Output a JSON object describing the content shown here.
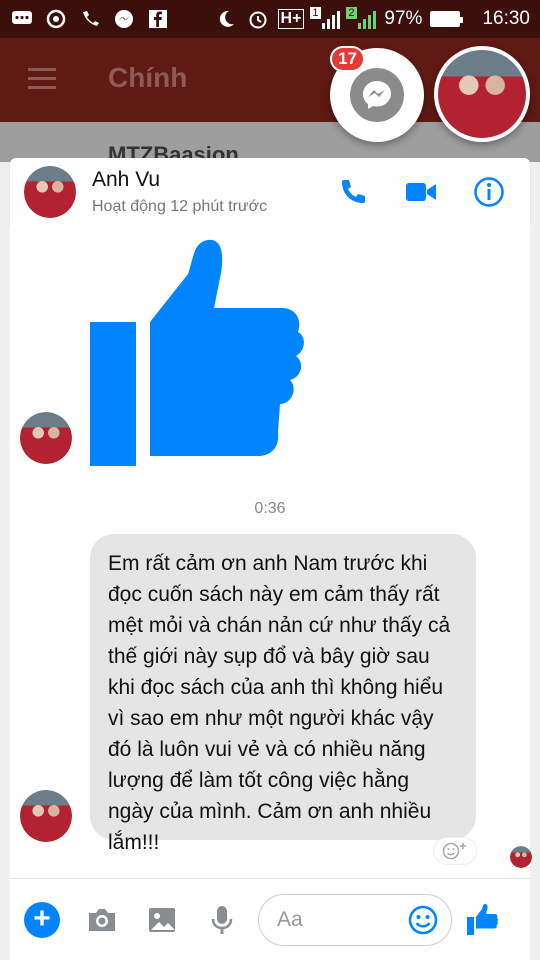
{
  "status_bar": {
    "battery": "97%",
    "battery_level": 0.97,
    "time": "16:30",
    "signal_badge_1": "1",
    "signal_badge_2": "2",
    "network": "H+"
  },
  "app_bar": {
    "title": "Chính"
  },
  "behind_item": {
    "title": "MTZBaasion"
  },
  "chat_heads": {
    "unread_count": "17"
  },
  "chat": {
    "contact_name": "Anh Vu",
    "active_status": "Hoạt động 12 phút trước",
    "timestamp": "0:36",
    "message": "Em rất cảm ơn anh Nam trước khi đọc cuốn sách này em cảm thấy rất mệt mỏi và chán nản cứ như thấy cả thế giới này sụp đổ và bây giờ sau khi đọc sách của anh thì không hiểu vì sao em như một người khác vậy đó là luôn vui vẻ và có nhiều năng lượng để làm tốt công việc hằng ngày của mình. Cảm ơn anh nhiều lắm!!!"
  },
  "composer": {
    "placeholder": "Aa"
  },
  "colors": {
    "accent": "#0084ff",
    "status_bar": "#3a0f0c",
    "app_bar": "#5f1a14",
    "badge": "#e53935",
    "bubble": "#e5e5e5"
  },
  "icons": [
    "messenger-icon",
    "phone-icon",
    "video-icon",
    "info-icon",
    "thumbs-up-icon",
    "plus-icon",
    "camera-icon",
    "image-icon",
    "microphone-icon",
    "emoji-icon"
  ]
}
